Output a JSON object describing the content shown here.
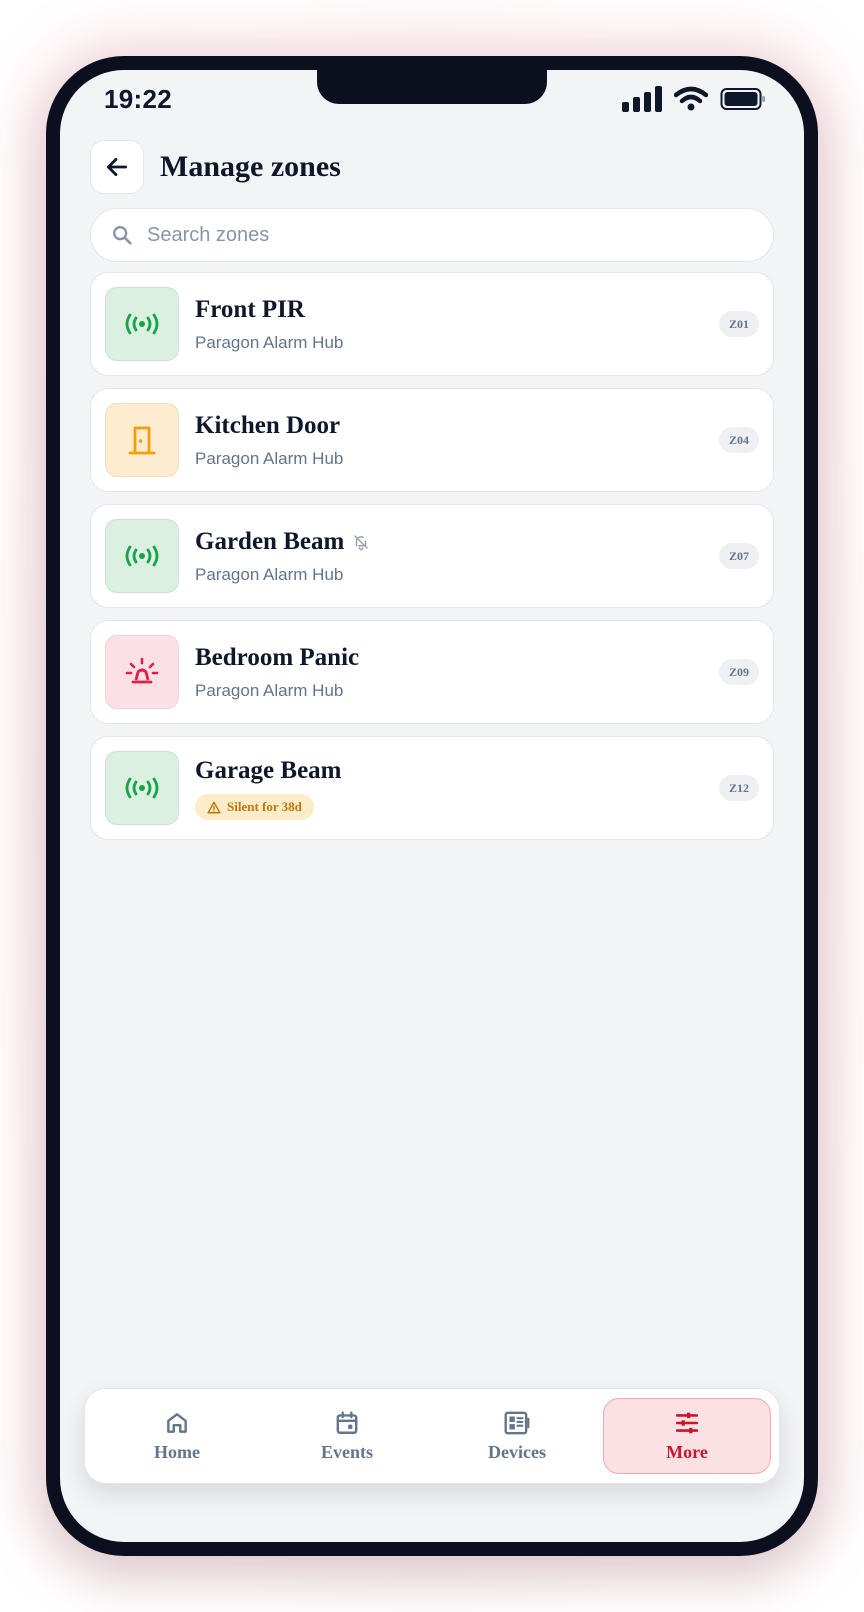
{
  "status_bar": {
    "time": "19:22"
  },
  "header": {
    "title": "Manage zones",
    "back_icon": "arrow-left-icon"
  },
  "search": {
    "placeholder": "Search zones",
    "value": ""
  },
  "colors": {
    "accent": "#c5162d",
    "ok_bg": "#dcf0e2",
    "ok_fg": "#16a34a",
    "door_bg": "#fdeccf",
    "door_fg": "#f59e0b",
    "panic_bg": "#fde0e5",
    "panic_fg": "#e11d48"
  },
  "zones": [
    {
      "name": "Front PIR",
      "subtitle": "Paragon Alarm Hub",
      "badge": "Z01",
      "icon": "motion-sensor-icon"
    },
    {
      "name": "Kitchen Door",
      "subtitle": "Paragon Alarm Hub",
      "badge": "Z04",
      "icon": "door-icon"
    },
    {
      "name": "Garden Beam",
      "subtitle": "Paragon Alarm Hub",
      "badge": "Z07",
      "icon": "motion-sensor-icon",
      "muted_icon": "bell-off-icon"
    },
    {
      "name": "Bedroom Panic",
      "subtitle": "Paragon Alarm Hub",
      "badge": "Z09",
      "icon": "siren-icon"
    },
    {
      "name": "Garage Beam",
      "warning": "Silent for 38d",
      "badge": "Z12",
      "icon": "motion-sensor-icon",
      "warning_icon": "warning-triangle-icon"
    }
  ],
  "nav": [
    {
      "label": "Home",
      "icon": "home-icon",
      "active": false
    },
    {
      "label": "Events",
      "icon": "calendar-icon",
      "active": false
    },
    {
      "label": "Devices",
      "icon": "devices-icon",
      "active": false
    },
    {
      "label": "More",
      "icon": "sliders-icon",
      "active": true
    }
  ]
}
